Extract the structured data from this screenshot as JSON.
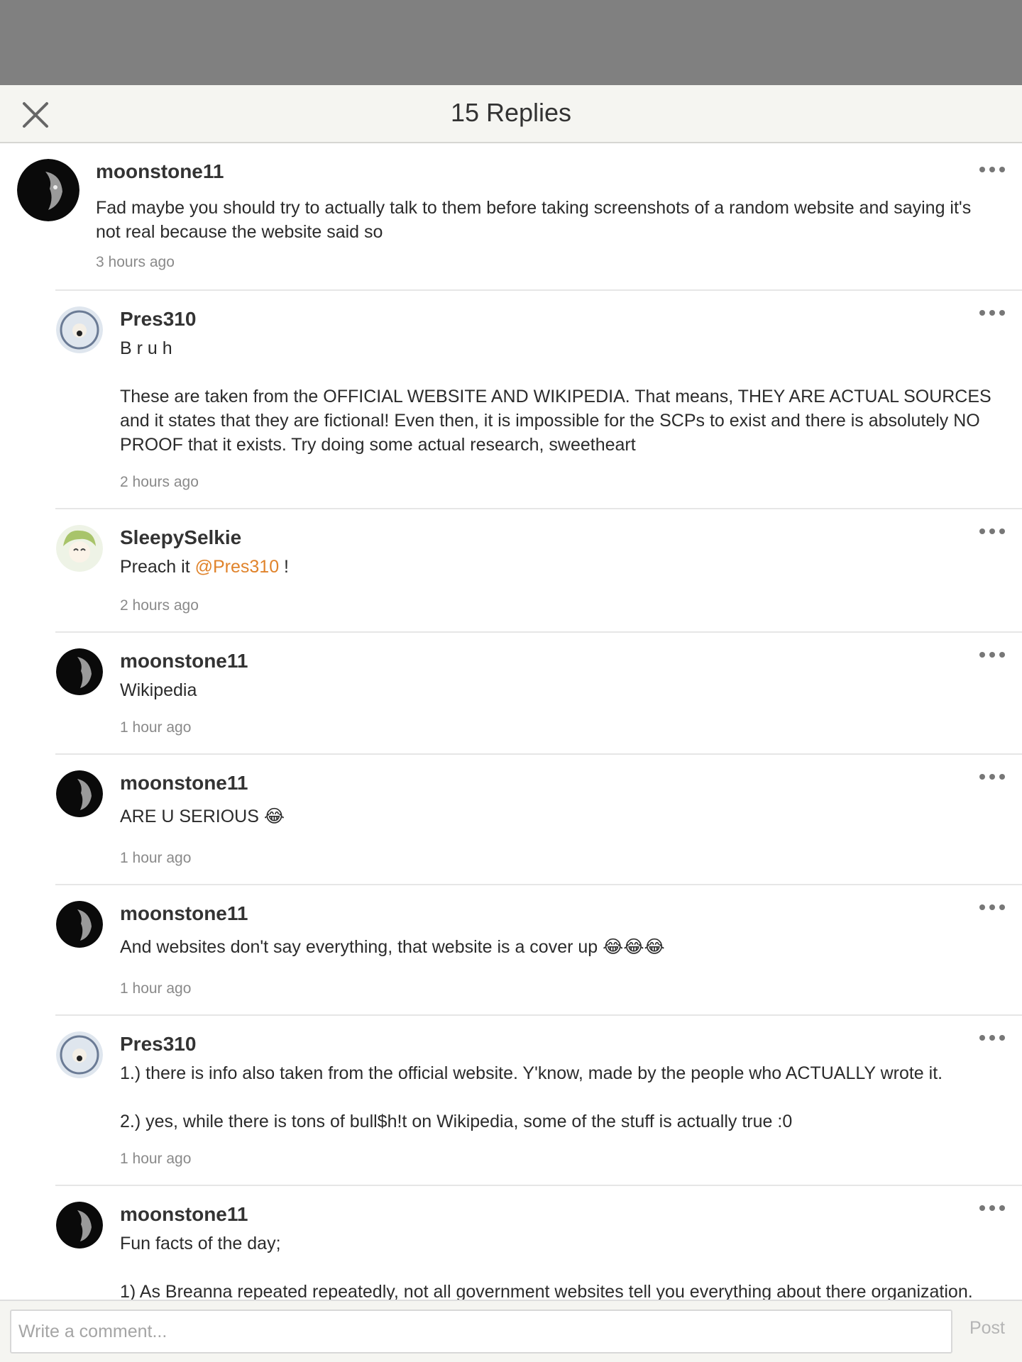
{
  "header": {
    "title": "15 Replies"
  },
  "parent": {
    "username": "moonstone11",
    "text": "Fad maybe you should try to actually talk to them before taking screenshots of a random website and saying it's not real because the website said so",
    "time": "3 hours ago"
  },
  "replies": [
    {
      "username": "Pres310",
      "para1": "B r u h",
      "para2": "These are taken from the OFFICIAL WEBSITE AND WIKIPEDIA. That means, THEY ARE ACTUAL SOURCES and it states that they are fictional! Even then, it is impossible for the SCPs to exist and there is absolutely NO PROOF that it exists. Try doing some actual research, sweetheart",
      "time": "2 hours ago"
    },
    {
      "username": "SleepySelkie",
      "text_before": "Preach it ",
      "mention": "@Pres310",
      "text_after": " !",
      "time": "2 hours ago"
    },
    {
      "username": "moonstone11",
      "text": "Wikipedia",
      "time": "1 hour ago"
    },
    {
      "username": "moonstone11",
      "text": "ARE U SERIOUS 😂",
      "time": "1 hour ago"
    },
    {
      "username": "moonstone11",
      "text": "And websites don't say everything, that website is a cover up 😂😂😂",
      "time": "1 hour ago"
    },
    {
      "username": "Pres310",
      "para1": "1.) there is info also taken from the official website. Y'know, made by the people who ACTUALLY wrote it.",
      "para2": "2.) yes, while there is tons of bull$h!t on Wikipedia, some of the stuff is actually true :0",
      "time": "1 hour ago"
    },
    {
      "username": "moonstone11",
      "para1": "Fun facts of the day;",
      "para2": "1) As Breanna repeated repeatedly, not all government websites tell you everything about there organization."
    }
  ],
  "composer": {
    "placeholder": "Write a comment...",
    "post_label": "Post"
  },
  "colors": {
    "mention": "#e0832b",
    "header_bg": "#f5f5f1",
    "overlay": "#808080"
  },
  "icons": {
    "close": "close-icon",
    "more": "more-options-icon"
  }
}
